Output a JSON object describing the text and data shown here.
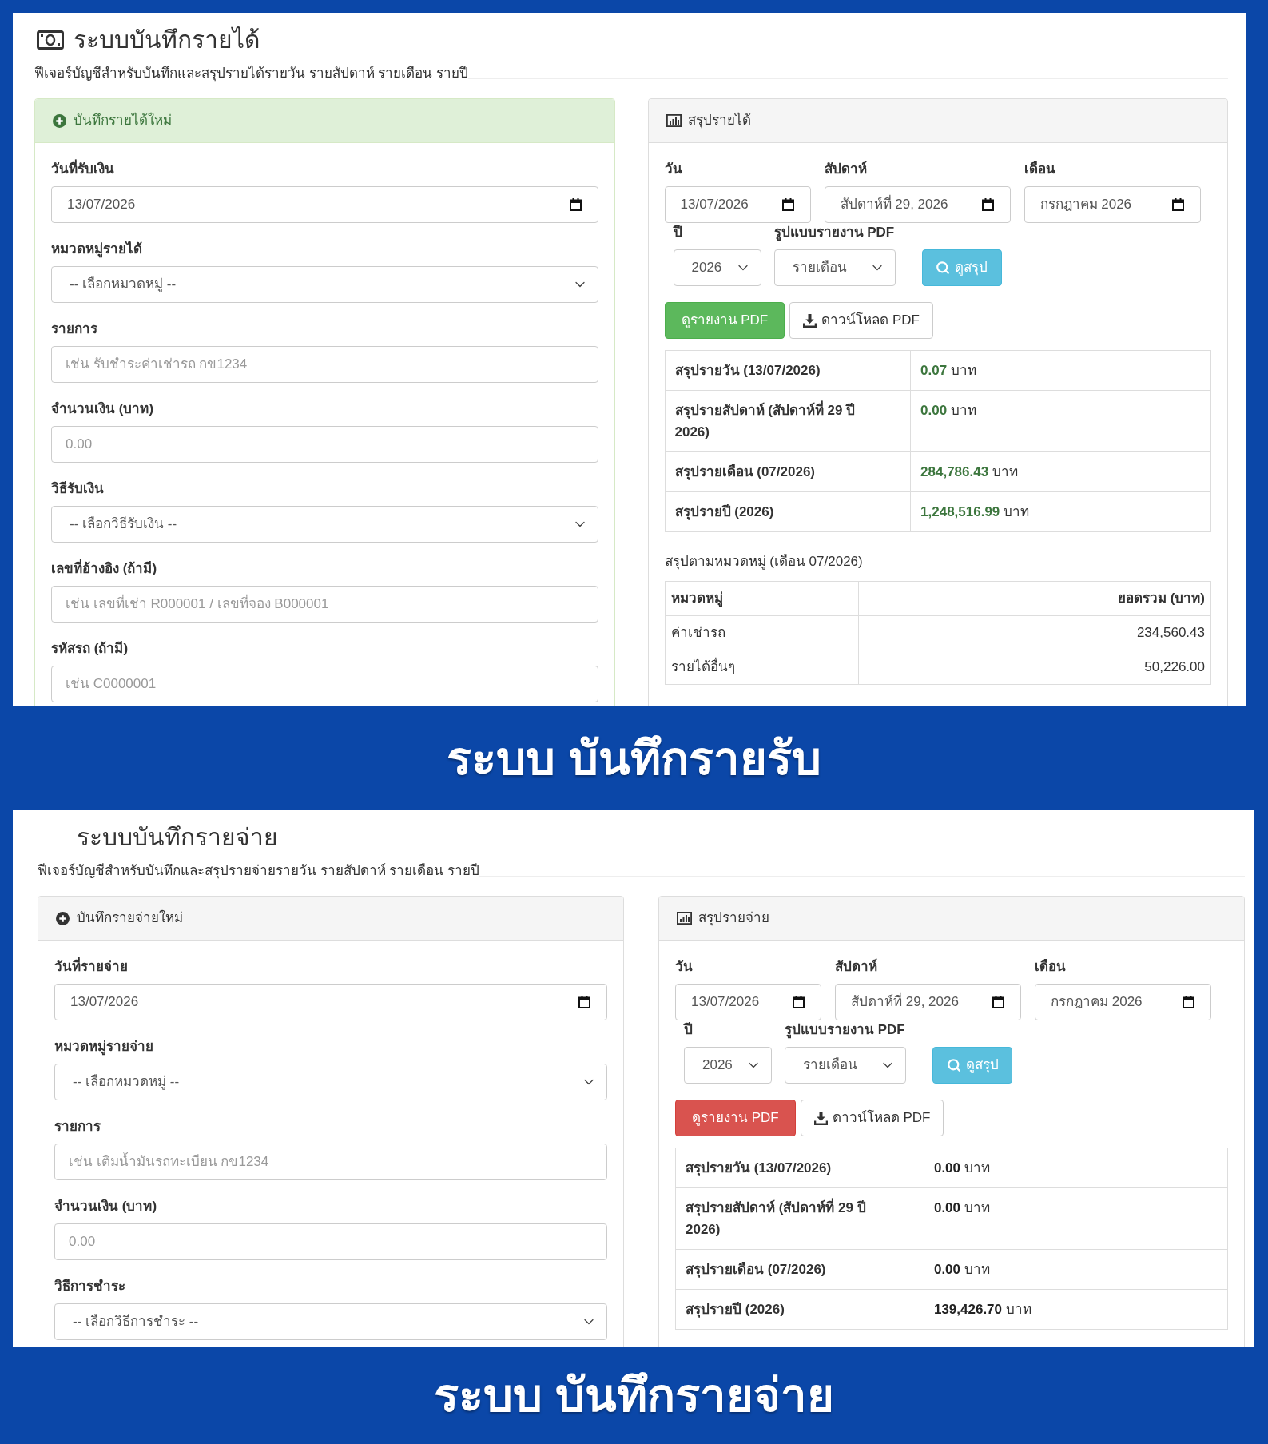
{
  "panels": [
    {
      "kind": "income",
      "title": "ระบบบันทึกรายได้",
      "subtitle": "ฟีเจอร์บัญชีสำหรับบันทึกและสรุปรายได้รายวัน รายสัปดาห์ รายเดือน รายปี",
      "entry_form": {
        "header": "บันทึกรายได้ใหม่",
        "fields": [
          {
            "kind": "date",
            "label": "วันที่รับเงิน",
            "value": "13/07/2026"
          },
          {
            "kind": "select",
            "label": "หมวดหมู่รายได้",
            "value": "-- เลือกหมวดหมู่ --"
          },
          {
            "kind": "text",
            "label": "รายการ",
            "placeholder": "เช่น รับชำระค่าเช่ารถ กข1234"
          },
          {
            "kind": "text",
            "label": "จำนวนเงิน (บาท)",
            "placeholder": "0.00"
          },
          {
            "kind": "select",
            "label": "วิธีรับเงิน",
            "value": "-- เลือกวิธีรับเงิน --"
          },
          {
            "kind": "text",
            "label": "เลขที่อ้างอิง (ถ้ามี)",
            "placeholder": "เช่น เลขที่เช่า R000001 / เลขที่จอง B000001"
          },
          {
            "kind": "text",
            "label": "รหัสรถ (ถ้ามี)",
            "placeholder": "เช่น C0000001"
          }
        ]
      },
      "summary": {
        "header": "สรุปรายได้",
        "period_fields": [
          {
            "kind": "date",
            "label": "วัน",
            "value": "13/07/2026"
          },
          {
            "kind": "date",
            "label": "สัปดาห์",
            "value": "สัปดาห์ที่ 29, 2026"
          },
          {
            "kind": "date",
            "label": "เดือน",
            "value": "กรกฎาคม 2026"
          }
        ],
        "report_fields": [
          {
            "kind": "select",
            "label": "ปี",
            "value": "2026"
          },
          {
            "kind": "select",
            "label": "รูปแบบรายงาน PDF",
            "value": "รายเดือน"
          }
        ],
        "view_button": "ดูสรุป",
        "pdf_buttons": [
          {
            "kind": "view",
            "label": "ดูรายงาน PDF"
          },
          {
            "kind": "download",
            "label": "ดาวน์โหลด PDF"
          }
        ],
        "totals": [
          {
            "label": "สรุปรายวัน (13/07/2026)",
            "amount": "0.07",
            "unit": "บาท"
          },
          {
            "label": "สรุปรายสัปดาห์ (สัปดาห์ที่ 29 ปี 2026)",
            "amount": "0.00",
            "unit": "บาท"
          },
          {
            "label": "สรุปรายเดือน (07/2026)",
            "amount": "284,786.43",
            "unit": "บาท"
          },
          {
            "label": "สรุปรายปี (2026)",
            "amount": "1,248,516.99",
            "unit": "บาท"
          }
        ],
        "category_title": "สรุปตามหมวดหมู่ (เดือน 07/2026)",
        "category_table": {
          "columns": [
            "หมวดหมู่",
            "ยอดรวม (บาท)"
          ],
          "rows": [
            [
              "ค่าเช่ารถ",
              "234,560.43"
            ],
            [
              "รายได้อื่นๆ",
              "50,226.00"
            ]
          ]
        }
      },
      "caption": "ระบบ บันทึกรายรับ"
    },
    {
      "kind": "expense",
      "title": "ระบบบันทึกรายจ่าย",
      "subtitle": "ฟีเจอร์บัญชีสำหรับบันทึกและสรุปรายจ่ายรายวัน รายสัปดาห์ รายเดือน รายปี",
      "entry_form": {
        "header": "บันทึกรายจ่ายใหม่",
        "fields": [
          {
            "kind": "date",
            "label": "วันที่รายจ่าย",
            "value": "13/07/2026"
          },
          {
            "kind": "select",
            "label": "หมวดหมู่รายจ่าย",
            "value": "-- เลือกหมวดหมู่ --"
          },
          {
            "kind": "text",
            "label": "รายการ",
            "placeholder": "เช่น เติมน้ำมันรถทะเบียน กข1234"
          },
          {
            "kind": "text",
            "label": "จำนวนเงิน (บาท)",
            "placeholder": "0.00"
          },
          {
            "kind": "select",
            "label": "วิธีการชำระ",
            "value": "-- เลือกวิธีการชำระ --"
          }
        ]
      },
      "summary": {
        "header": "สรุปรายจ่าย",
        "period_fields": [
          {
            "kind": "date",
            "label": "วัน",
            "value": "13/07/2026"
          },
          {
            "kind": "date",
            "label": "สัปดาห์",
            "value": "สัปดาห์ที่ 29, 2026"
          },
          {
            "kind": "date",
            "label": "เดือน",
            "value": "กรกฎาคม 2026"
          }
        ],
        "report_fields": [
          {
            "kind": "select",
            "label": "ปี",
            "value": "2026"
          },
          {
            "kind": "select",
            "label": "รูปแบบรายงาน PDF",
            "value": "รายเดือน"
          }
        ],
        "view_button": "ดูสรุป",
        "pdf_buttons": [
          {
            "kind": "view",
            "label": "ดูรายงาน PDF"
          },
          {
            "kind": "download",
            "label": "ดาวน์โหลด PDF"
          }
        ],
        "totals": [
          {
            "label": "สรุปรายวัน (13/07/2026)",
            "amount": "0.00",
            "unit": "บาท"
          },
          {
            "label": "สรุปรายสัปดาห์ (สัปดาห์ที่ 29 ปี 2026)",
            "amount": "0.00",
            "unit": "บาท"
          },
          {
            "label": "สรุปรายเดือน (07/2026)",
            "amount": "0.00",
            "unit": "บาท"
          },
          {
            "label": "สรุปรายปี (2026)",
            "amount": "139,426.70",
            "unit": "บาท"
          }
        ]
      },
      "caption": "ระบบ บันทึกรายจ่าย"
    }
  ]
}
